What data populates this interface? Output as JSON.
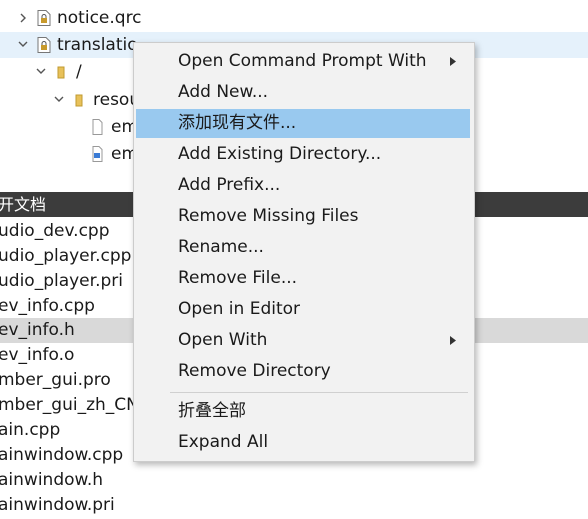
{
  "project_tree": {
    "items": [
      {
        "label": "notice.qrc",
        "icon": "qrc-file-icon",
        "arrow": "chevron-right-icon"
      },
      {
        "label": "translatio",
        "icon": "qrc-file-icon",
        "arrow": "chevron-down-icon"
      },
      {
        "label": "/",
        "icon": "folder-icon",
        "arrow": "chevron-down-icon"
      },
      {
        "label": "resou",
        "icon": "folder-icon",
        "arrow": "chevron-down-icon"
      },
      {
        "label": "em",
        "icon": "file-icon"
      },
      {
        "label": "em",
        "icon": "qm-file-icon"
      }
    ]
  },
  "open_documents": {
    "header": "开文档",
    "files": [
      "udio_dev.cpp",
      "udio_player.cpp",
      "udio_player.pri",
      "ev_info.cpp",
      "ev_info.h",
      "ev_info.o",
      "mber_gui.pro",
      "mber_gui_zh_CN",
      "ain.cpp",
      "ainwindow.cpp",
      "ainwindow.h",
      "ainwindow.pri"
    ],
    "active_index": 4
  },
  "context_menu": {
    "items": [
      {
        "label": "Open Command Prompt With",
        "submenu": true
      },
      {
        "label": "Add New..."
      },
      {
        "label": "添加现有文件...",
        "highlighted": true
      },
      {
        "label": "Add Existing Directory..."
      },
      {
        "label": "Add Prefix..."
      },
      {
        "label": "Remove Missing Files"
      },
      {
        "label": "Rename..."
      },
      {
        "label": "Remove File..."
      },
      {
        "label": "Open in Editor"
      },
      {
        "label": "Open With",
        "submenu": true
      },
      {
        "label": "Remove Directory"
      }
    ],
    "extra_items": [
      {
        "label": "折叠全部"
      },
      {
        "label": "Expand All"
      }
    ]
  },
  "colors": {
    "menu_background": "#f2f2f2",
    "menu_highlight": "#99c9ef",
    "tree_selection": "#e5f1fb",
    "docs_header": "#3c3c3c",
    "active_document": "#d9d9d9"
  }
}
